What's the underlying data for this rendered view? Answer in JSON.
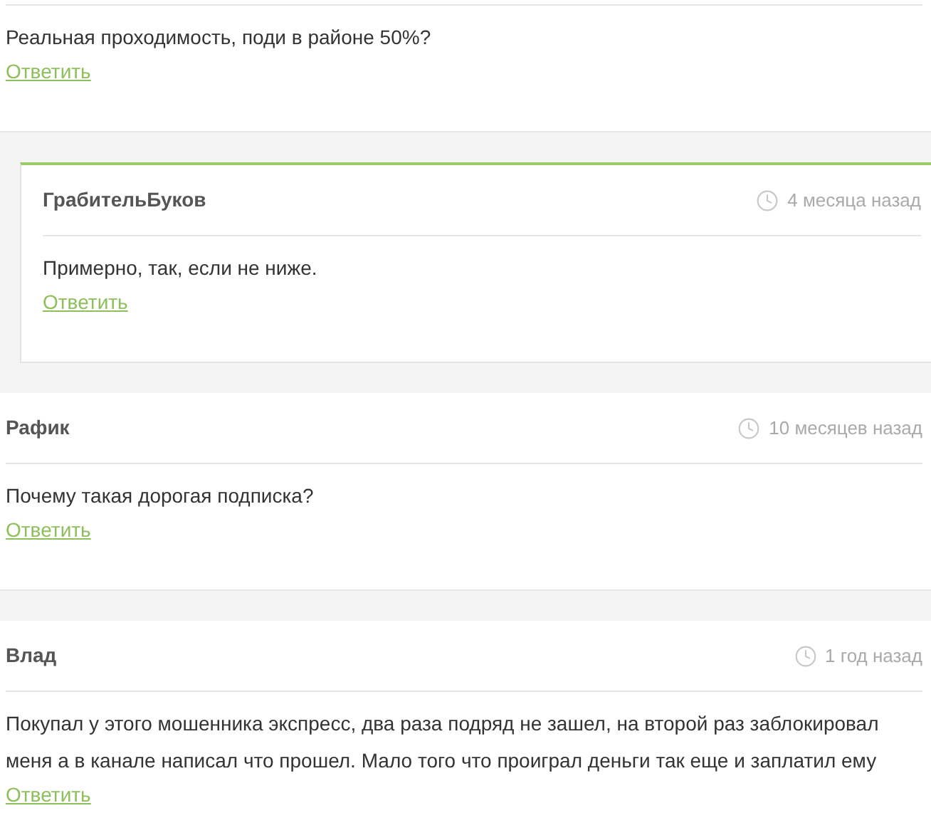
{
  "comments": [
    {
      "text": "Реальная проходимость, поди в районе 50%?",
      "reply_label": "Ответить",
      "replies": [
        {
          "author": "ГрабительБуков",
          "time": "4 месяца назад",
          "text": "Примерно, так, если не ниже.",
          "reply_label": "Ответить"
        }
      ]
    },
    {
      "author": "Рафик",
      "time": "10 месяцев назад",
      "text": "Почему такая дорогая подписка?",
      "reply_label": "Ответить"
    },
    {
      "author": "Влад",
      "time": "1 год назад",
      "text": "Покупал у этого мошенника экспресс, два раза подряд не зашел, на второй раз заблокировал меня а в канале написал что прошел. Мало того что проиграл деньги так еще и заплатил ему",
      "reply_label": "Ответить"
    }
  ]
}
